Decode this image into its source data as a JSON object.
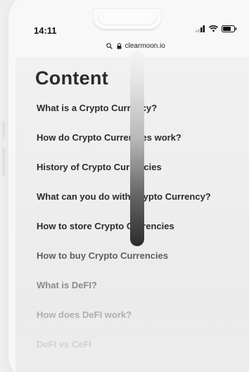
{
  "status_bar": {
    "time": "14:11"
  },
  "browser": {
    "url": "clearmoon.io",
    "lock_icon": "lock-icon",
    "search_icon": "search-icon"
  },
  "page": {
    "title": "Content"
  },
  "toc": {
    "items": [
      {
        "label": "What is a Crypto Currency?",
        "color": "#2b2b2b"
      },
      {
        "label": "How do Crypto Currencies work?",
        "color": "#2b2b2b"
      },
      {
        "label": "History of Crypto Currencies",
        "color": "#2b2b2b"
      },
      {
        "label": "What can you do with Crypto Currency?",
        "color": "#2b2b2b"
      },
      {
        "label": "How to store Crypto Currencies",
        "color": "#2b2b2b"
      },
      {
        "label": "How to buy Crypto Currencies",
        "color": "#5e5e5e"
      },
      {
        "label": "What is DeFI?",
        "color": "#8a8a8a"
      },
      {
        "label": "How does DeFI work?",
        "color": "#a7a7a7"
      },
      {
        "label": "DeFI vs CeFI",
        "color": "#c3c3c3"
      }
    ]
  }
}
